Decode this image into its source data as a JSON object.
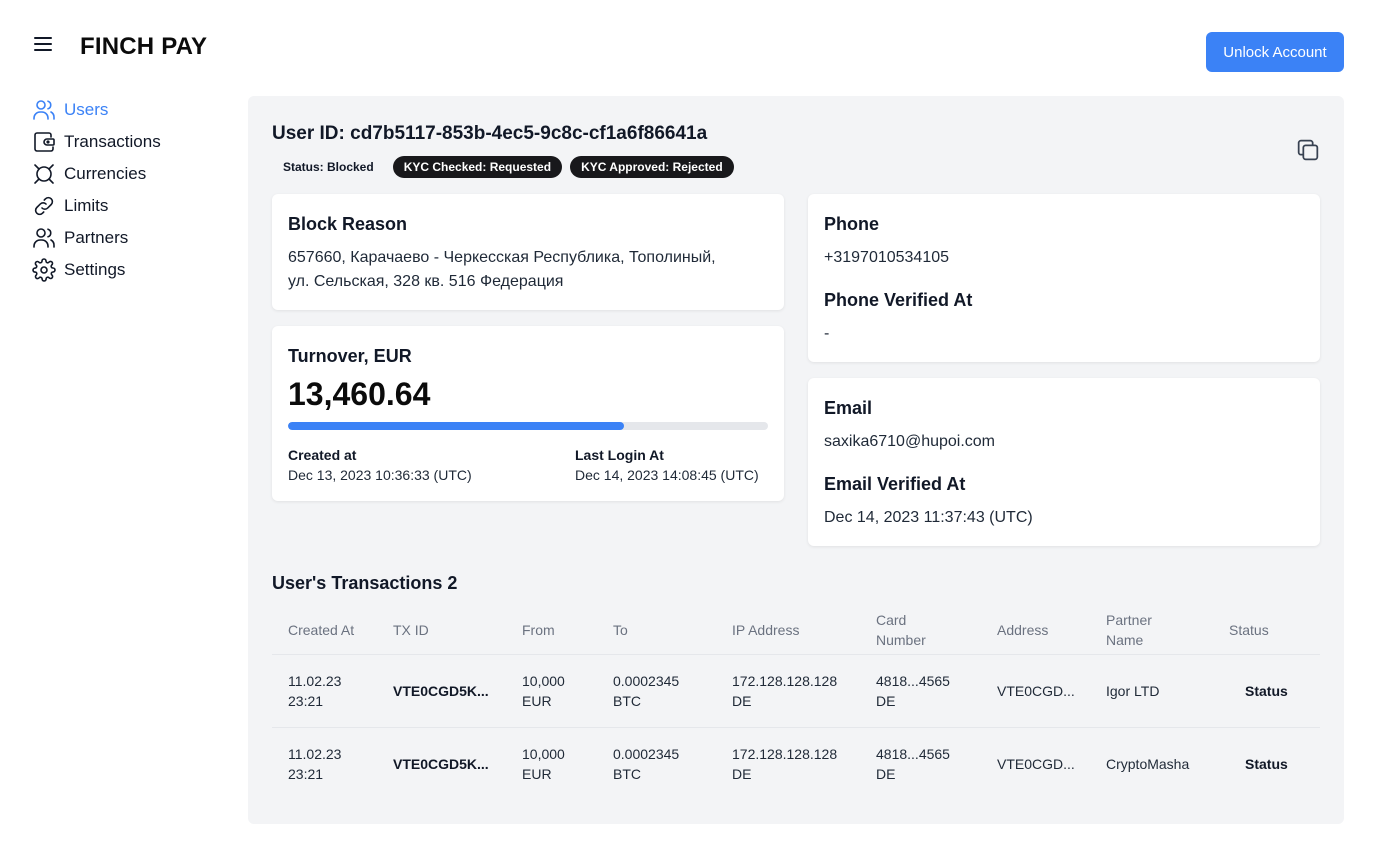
{
  "app": {
    "brand": "FINCH PAY",
    "unlock_label": "Unlock Account"
  },
  "sidebar": {
    "items": [
      {
        "label": "Users",
        "icon": "users-icon",
        "active": true
      },
      {
        "label": "Transactions",
        "icon": "wallet-icon"
      },
      {
        "label": "Currencies",
        "icon": "currency-icon"
      },
      {
        "label": "Limits",
        "icon": "link-icon"
      },
      {
        "label": "Partners",
        "icon": "partners-icon"
      },
      {
        "label": "Settings",
        "icon": "gear-icon"
      }
    ]
  },
  "user": {
    "id_text": "User ID: cd7b5117-853b-4ec5-9c8c-cf1a6f86641a",
    "badges": [
      "Status: Blocked",
      "KYC Checked: Requested",
      "KYC Approved: Rejected"
    ]
  },
  "block_reason": {
    "title": "Block Reason",
    "line1": "657660, Карачаево - Черкесская Республика, Тополиный,",
    "line2": "ул. Сельская, 328 кв. 516 Федерация"
  },
  "turnover": {
    "title": "Turnover, EUR",
    "value": "13,460.64",
    "progress_fraction": 0.7,
    "created_label": "Created at",
    "created_value": "Dec 13, 2023 10:36:33 (UTC)",
    "last_login_label": "Last Login At",
    "last_login_value": "Dec 14, 2023 14:08:45 (UTC)"
  },
  "phone": {
    "title": "Phone",
    "value": "+3197010534105",
    "verified_title": "Phone Verified At",
    "verified_value": "-"
  },
  "email": {
    "title": "Email",
    "value": "saxika6710@hupoi.com",
    "verified_title": "Email Verified At",
    "verified_value": "Dec 14, 2023 11:37:43 (UTC)"
  },
  "transactions": {
    "title": "User's Transactions 2",
    "headers": {
      "created": "Created At",
      "txid": "TX ID",
      "from": "From",
      "to": "To",
      "ip": "IP Address",
      "card_1": "Card",
      "card_2": "Number",
      "address": "Address",
      "partner_1": "Partner",
      "partner_2": "Name",
      "status": "Status"
    },
    "rows": [
      {
        "date": "11.02.23",
        "time": "23:21",
        "txid": "VTE0CGD5K...",
        "from_amount": "10,000",
        "from_ccy": "EUR",
        "to_amount": "0.0002345",
        "to_ccy": "BTC",
        "ip": "172.128.128.128",
        "ip_country": "DE",
        "card": "4818...4565",
        "card_country": "DE",
        "address": "VTE0CGD...",
        "partner": "Igor LTD",
        "status": "Status"
      },
      {
        "date": "11.02.23",
        "time": "23:21",
        "txid": "VTE0CGD5K...",
        "from_amount": "10,000",
        "from_ccy": "EUR",
        "to_amount": "0.0002345",
        "to_ccy": "BTC",
        "ip": "172.128.128.128",
        "ip_country": "DE",
        "card": "4818...4565",
        "card_country": "DE",
        "address": "VTE0CGD...",
        "partner": "CryptoMasha",
        "status": "Status"
      }
    ]
  },
  "colors": {
    "accent": "#3b82f6",
    "panel": "#f3f4f6",
    "badge_dark": "#18181b"
  }
}
